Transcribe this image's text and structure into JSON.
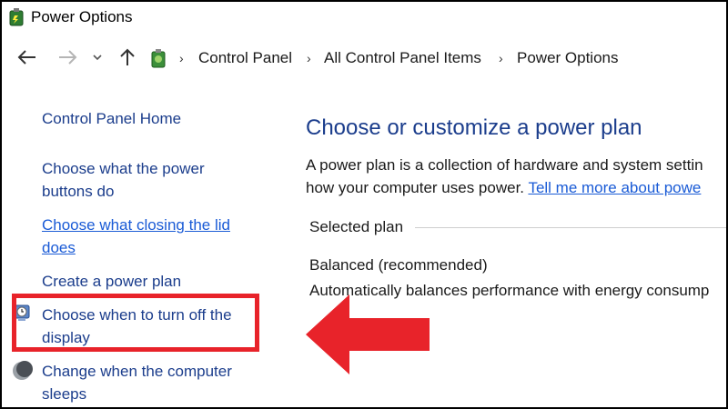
{
  "window": {
    "title": "Power Options",
    "icon": "power-options-battery-icon"
  },
  "nav": {
    "back_icon": "back-arrow-icon",
    "forward_icon": "forward-arrow-icon",
    "recent_icon": "chevron-down-icon",
    "up_icon": "up-arrow-icon",
    "breadcrumb": [
      "Control Panel",
      "All Control Panel Items",
      "Power Options"
    ],
    "separator": "›"
  },
  "sidebar": {
    "home": "Control Panel Home",
    "items": [
      {
        "label_line1": "Choose what the power",
        "label_line2": "buttons do"
      },
      {
        "label_line1": "Choose what closing the lid",
        "label_line2": "does"
      },
      {
        "label_line1": "Create a power plan"
      },
      {
        "label_line1": "Choose when to turn off the",
        "label_line2": "display",
        "icon": "display-clock-icon"
      },
      {
        "label_line1": "Change when the computer",
        "label_line2": "sleeps",
        "icon": "moon-icon"
      }
    ]
  },
  "main": {
    "title": "Choose or customize a power plan",
    "desc_line1": "A power plan is a collection of hardware and system settin",
    "desc_line2_prefix": "how your computer uses power.",
    "desc_link": "Tell me more about powe",
    "section_label": "Selected plan",
    "plan_name": "Balanced (recommended)",
    "plan_desc": "Automatically balances performance with energy consump"
  },
  "colors": {
    "link": "#1b3d8c",
    "link_underlined": "#1a5bd6",
    "highlight": "#e8232a",
    "border": "#000000"
  }
}
